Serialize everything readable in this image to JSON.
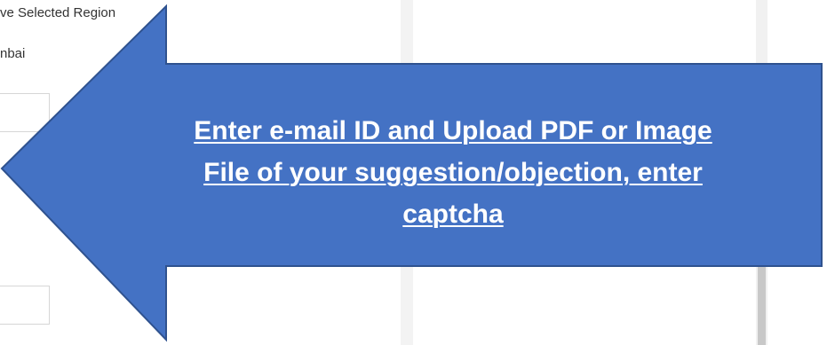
{
  "form": {
    "region_label": "ve Selected Region",
    "region_value": "nbai",
    "email_input_value": "",
    "file_input_value": ""
  },
  "callout": {
    "lines": [
      "Enter e-mail ID and Upload PDF or Image",
      "File of your suggestion/objection, enter",
      "captcha"
    ],
    "fill_color": "#4472C4",
    "stroke_color": "#2F528F",
    "text_color": "#FFFFFF"
  }
}
